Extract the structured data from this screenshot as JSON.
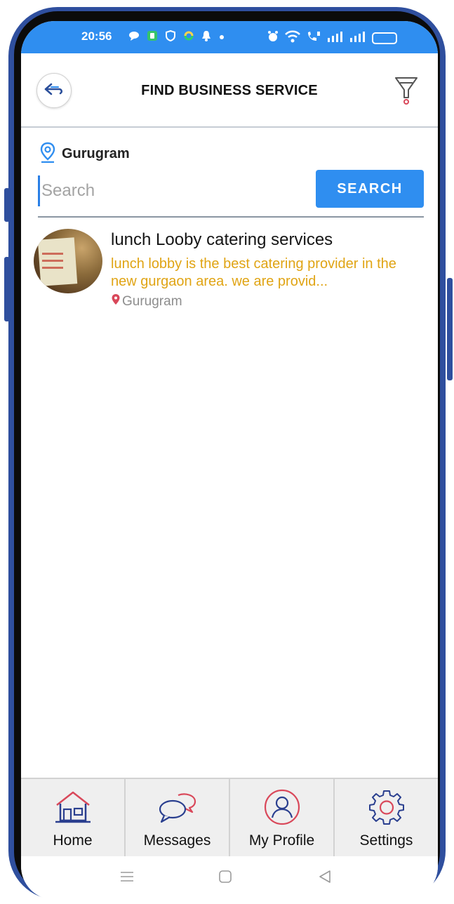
{
  "status_bar": {
    "time": "20:56",
    "icons": [
      "chat-icon",
      "app-icon",
      "shield-icon",
      "sync-icon",
      "bell-icon",
      "dot-icon",
      "alarm-icon",
      "wifi-icon",
      "volte-icon",
      "signal-icon",
      "signal-icon",
      "battery-icon"
    ]
  },
  "header": {
    "title": "FIND BUSINESS SERVICE",
    "back_icon": "back-arrow-icon",
    "filter_icon": "filter-icon"
  },
  "location": {
    "icon": "location-pin-icon",
    "label": "Gurugram"
  },
  "search": {
    "placeholder": "Search",
    "value": "",
    "button_label": "SEARCH"
  },
  "results": [
    {
      "title": "lunch Looby catering services",
      "description": "lunch lobby is the best catering provider in the new gurgaon area. we are provid...",
      "location": "Gurugram"
    }
  ],
  "bottom_nav": {
    "items": [
      {
        "label": "Home",
        "icon": "home-icon"
      },
      {
        "label": "Messages",
        "icon": "messages-icon"
      },
      {
        "label": "My Profile",
        "icon": "profile-icon"
      },
      {
        "label": "Settings",
        "icon": "settings-icon"
      }
    ]
  },
  "system_nav": {
    "icons": [
      "menu-icon",
      "home-square-icon",
      "back-triangle-icon"
    ]
  },
  "colors": {
    "primary": "#2f8ef0",
    "description_text": "#e0a414",
    "frame": "#2f4f9e",
    "icon_red": "#d9485a"
  }
}
